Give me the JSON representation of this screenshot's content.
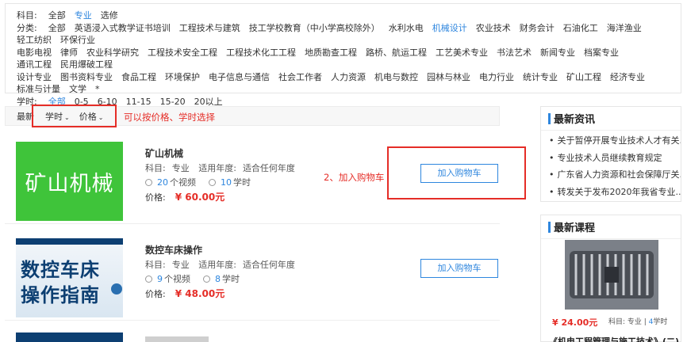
{
  "filters": {
    "subject": {
      "label": "科目:",
      "options": [
        "全部",
        "专业",
        "选修"
      ],
      "active_index": 1
    },
    "category": {
      "label": "分类:",
      "line1": [
        "全部",
        "英语浸入式教学证书培训",
        "工程技术与建筑",
        "技工学校教育（中小学高校除外）",
        "水利水电",
        "机械设计",
        "农业技术",
        "财务会计",
        "石油化工",
        "海洋渔业",
        "轻工纺织",
        "环保行业"
      ],
      "line2": [
        "电影电视",
        "律师",
        "农业科学研究",
        "工程技术安全工程",
        "工程技术化工工程",
        "地质勘查工程",
        "路桥、航运工程",
        "工艺美术专业",
        "书法艺术",
        "新闻专业",
        "档案专业",
        "通讯工程",
        "民用爆破工程"
      ],
      "line3": [
        "设计专业",
        "图书资料专业",
        "食品工程",
        "环境保护",
        "电子信息与通信",
        "社会工作者",
        "人力资源",
        "机电与数控",
        "园林与林业",
        "电力行业",
        "统计专业",
        "矿山工程",
        "经济专业",
        "标准与计量",
        "文学",
        "*"
      ],
      "active": "机械设计"
    },
    "hours": {
      "label": "学时:",
      "options": [
        "全部",
        "0-5",
        "6-10",
        "11-15",
        "15-20",
        "20以上"
      ],
      "active_index": 0
    }
  },
  "sortbar": {
    "label": "最新",
    "hours": "学时",
    "price": "价格",
    "note": "可以按价格、学时选择"
  },
  "courses": [
    {
      "thumb_text": "矿山机械",
      "title": "矿山机械",
      "subject_label": "科目:",
      "subject": "专业",
      "year_label": "适用年度:",
      "year": "适合任何年度",
      "videos": "20",
      "videos_unit": "个视频",
      "hours": "10",
      "hours_unit": "学时",
      "price_label": "价格:",
      "price": "¥ 60.00元",
      "cart": "加入购物车"
    },
    {
      "thumb_line1": "数控车床",
      "thumb_line2": "操作指南",
      "title": "数控车床操作",
      "subject_label": "科目:",
      "subject": "专业",
      "year_label": "适用年度:",
      "year": "适合任何年度",
      "videos": "9",
      "videos_unit": "个视频",
      "hours": "8",
      "hours_unit": "学时",
      "price_label": "价格:",
      "price": "¥ 48.00元",
      "cart": "加入购物车"
    }
  ],
  "cart_note": "2、加入购物车",
  "sidebar": {
    "news_title": "最新资讯",
    "news": [
      "关于暂停开展专业技术人才有关...",
      "专业技术人员继续教育规定",
      "广东省人力资源和社会保障厅关...",
      "转发关于发布2020年我省专业..."
    ],
    "courses_title": "最新课程",
    "course_price": "¥ 24.00元",
    "course_subject": "科目: 专业 |",
    "course_hours": "4",
    "course_hours_unit": "学时",
    "next_title": "《机电工程管理与施工技术》(二)"
  },
  "colors": {
    "accent": "#2e86de",
    "highlight": "#e52d27",
    "thumb_green": "#3fc43a"
  }
}
